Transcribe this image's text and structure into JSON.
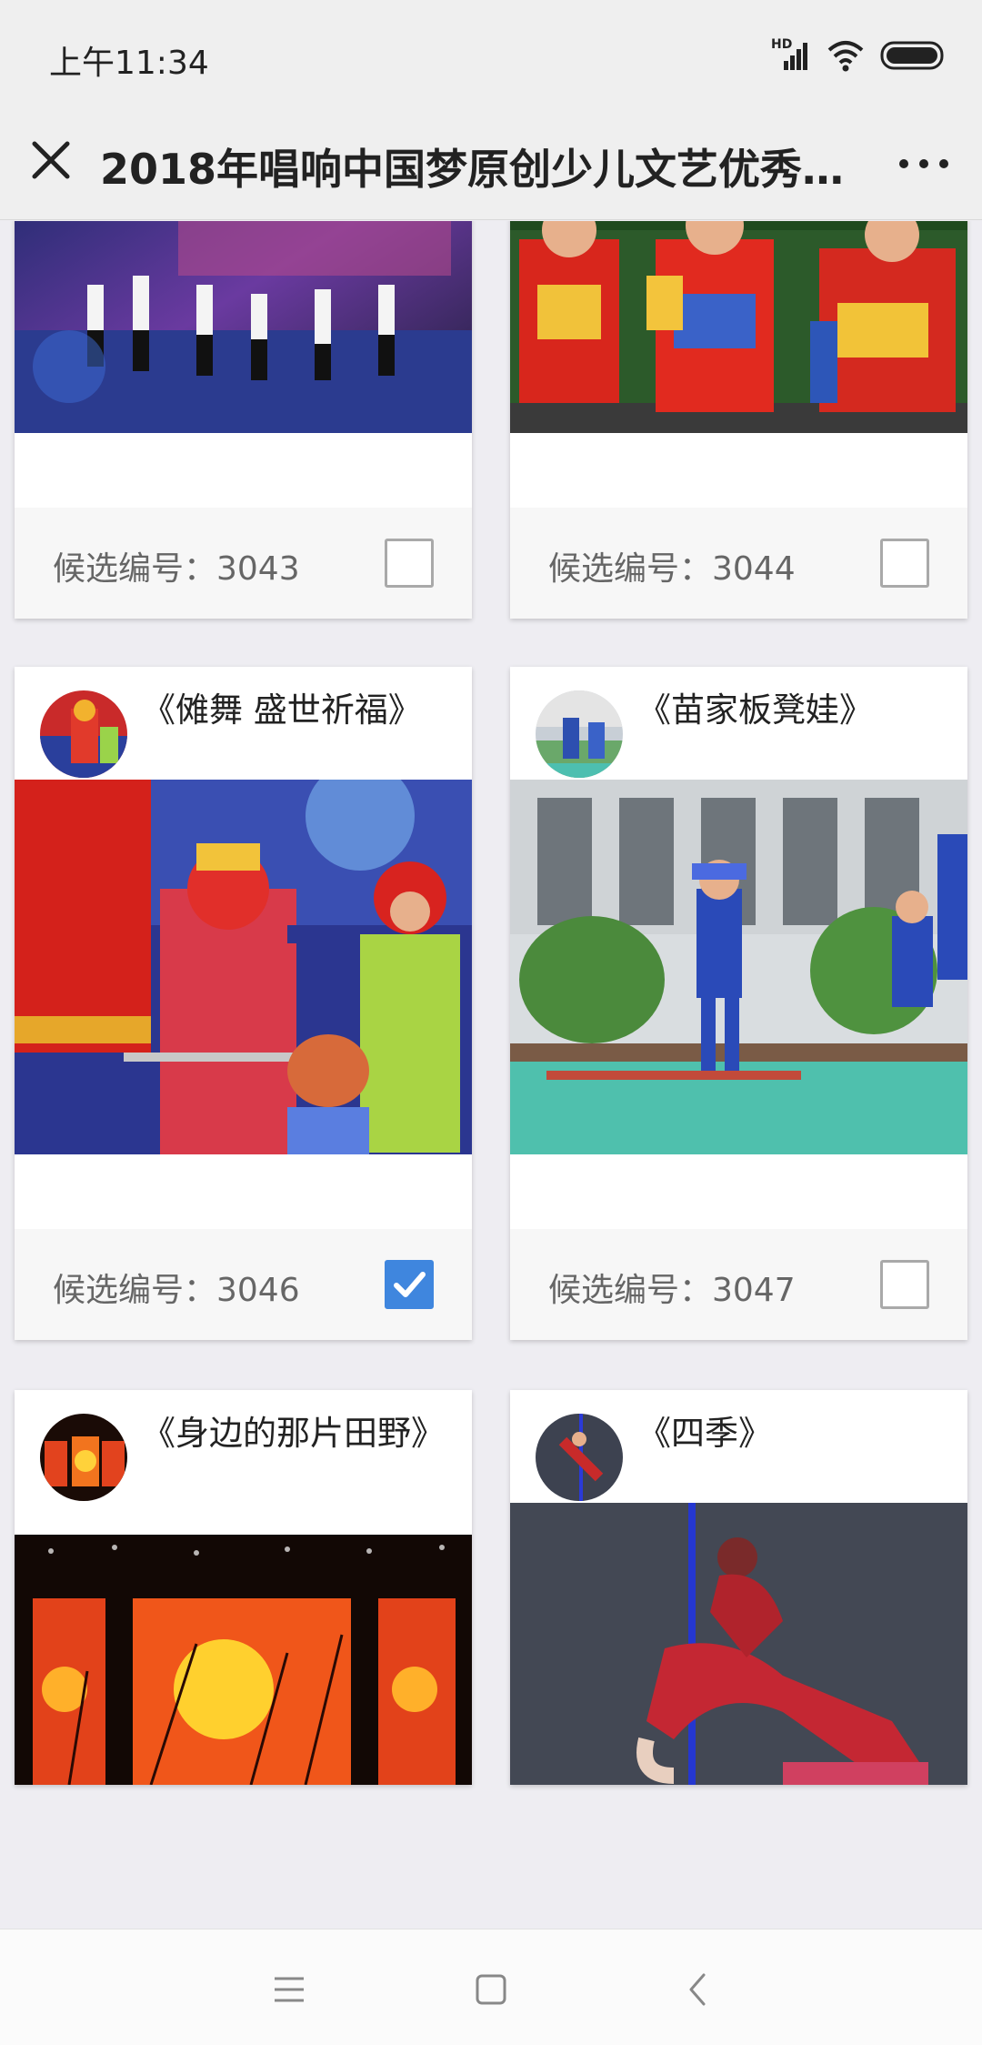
{
  "status_bar": {
    "time": "上午11:34",
    "network_badge": "HD",
    "icons": [
      "signal-icon",
      "wifi-icon",
      "battery-icon"
    ]
  },
  "nav": {
    "title": "2018年唱响中国梦原创少儿文艺优秀...",
    "close_icon": "close-icon",
    "more_icon": "more-icon"
  },
  "candidate_prefix": "候选编号",
  "cards": [
    {
      "title": "",
      "candidate_number": "3043",
      "checked": false
    },
    {
      "title": "",
      "candidate_number": "3044",
      "checked": false
    },
    {
      "title": "《傩舞 盛世祈福》",
      "candidate_number": "3046",
      "checked": true
    },
    {
      "title": "《苗家板凳娃》",
      "candidate_number": "3047",
      "checked": false
    },
    {
      "title": "《身边的那片田野》",
      "candidate_number": "",
      "checked": false
    },
    {
      "title": "《四季》",
      "candidate_number": "",
      "checked": false
    }
  ],
  "candidate_labels": [
    "候选编号：3043",
    "候选编号：3044",
    "候选编号：3046",
    "候选编号：3047"
  ],
  "bottom_nav": {
    "icons": [
      "menu-icon",
      "home-icon",
      "back-icon"
    ]
  },
  "colors": {
    "accent": "#3f86de",
    "background": "#eeedf2",
    "bar": "#efefef"
  }
}
